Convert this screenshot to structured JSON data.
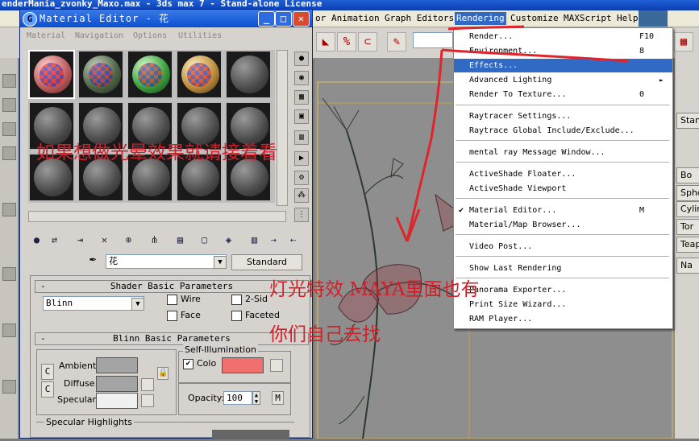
{
  "main_window": {
    "title": "enderMania_zvonky_Maxo.max - 3ds max 7 - Stand-alone License",
    "menu": [
      {
        "label": "or"
      },
      {
        "label": "Animation"
      },
      {
        "label": "Graph Editors"
      },
      {
        "label": "Rendering"
      },
      {
        "label": "Customize"
      },
      {
        "label": "MAXScript"
      },
      {
        "label": "Help"
      }
    ],
    "toolbar_field_value": "",
    "command_panel_items": [
      "Stan",
      "Bo",
      "Sphe",
      "Cylin",
      "Tor",
      "Teap",
      "Na"
    ]
  },
  "material_editor": {
    "title": "Material Editor - 花",
    "menu": [
      "Material",
      "Navigation",
      "Options",
      "Utilities"
    ],
    "material_name": "花",
    "material_type_button": "Standard",
    "shader_rollout": {
      "title": "Shader Basic Parameters",
      "shader": "Blinn",
      "wire_label": "Wire",
      "two_sided_label": "2-Sid",
      "face_map_label": "Face",
      "faceted_label": "Faceted"
    },
    "blinn_rollout": {
      "title": "Blinn Basic Parameters",
      "self_illum_title": "Self-Illumination",
      "color_label": "Colo",
      "ambient_label": "Ambient:",
      "diffuse_label": "Diffuse:",
      "specular_label": "Specular:",
      "opacity_label": "Opacity:",
      "opacity_value": "100",
      "map_button": "M",
      "lock_c": "C"
    },
    "specular_title": "Specular Highlights",
    "colors": {
      "ambient": "#a4a4a4",
      "diffuse": "#a4a4a4",
      "specular": "#f0f0f0",
      "self_illum": "#f07070"
    }
  },
  "rendering_menu": {
    "items": [
      {
        "label": "Render...",
        "shortcut": "F10"
      },
      {
        "label": "Environment...",
        "shortcut": "8"
      },
      {
        "label": "Effects...",
        "shortcut": ""
      },
      {
        "label": "Advanced Lighting",
        "shortcut": ""
      },
      {
        "label": "Render To Texture...",
        "shortcut": "0"
      },
      {
        "label": "Raytracer Settings...",
        "shortcut": ""
      },
      {
        "label": "Raytrace Global Include/Exclude...",
        "shortcut": ""
      },
      {
        "label": "mental ray Message Window...",
        "shortcut": ""
      },
      {
        "label": "ActiveShade Floater...",
        "shortcut": ""
      },
      {
        "label": "ActiveShade Viewport",
        "shortcut": ""
      },
      {
        "label": "Material Editor...",
        "shortcut": "M"
      },
      {
        "label": "Material/Map Browser...",
        "shortcut": ""
      },
      {
        "label": "Video Post...",
        "shortcut": ""
      },
      {
        "label": "Show Last Rendering",
        "shortcut": ""
      },
      {
        "label": "Panorama Exporter...",
        "shortcut": ""
      },
      {
        "label": "Print Size Wizard...",
        "shortcut": ""
      },
      {
        "label": "RAM Player...",
        "shortcut": ""
      }
    ],
    "checkmark": "✔",
    "submenu_arrow": "►"
  },
  "annotations": {
    "line1": "如果想做光晕效果就请接着看",
    "line2": "灯光特效 MAYA里面也有",
    "line3": "你们自己去找"
  },
  "accent_colors": {
    "highlight": "#316ac5",
    "annotation": "#e0242c"
  }
}
